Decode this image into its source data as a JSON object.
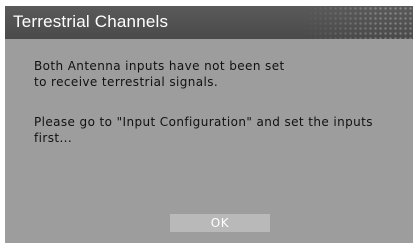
{
  "window": {
    "title": "Terrestrial Channels"
  },
  "message": {
    "paragraph1": [
      "Both Antenna inputs have not been set",
      "to receive terrestrial signals."
    ],
    "paragraph2": [
      "Please go to \"Input Configuration\" and set the inputs",
      "first..."
    ]
  },
  "buttons": {
    "ok_label": "OK"
  },
  "colors": {
    "dialog_bg": "#9d9d9d",
    "title_bar_bg": "#4d4d4d",
    "button_bg": "#b9b9b9",
    "text": "#111111",
    "title_text": "#ffffff"
  }
}
